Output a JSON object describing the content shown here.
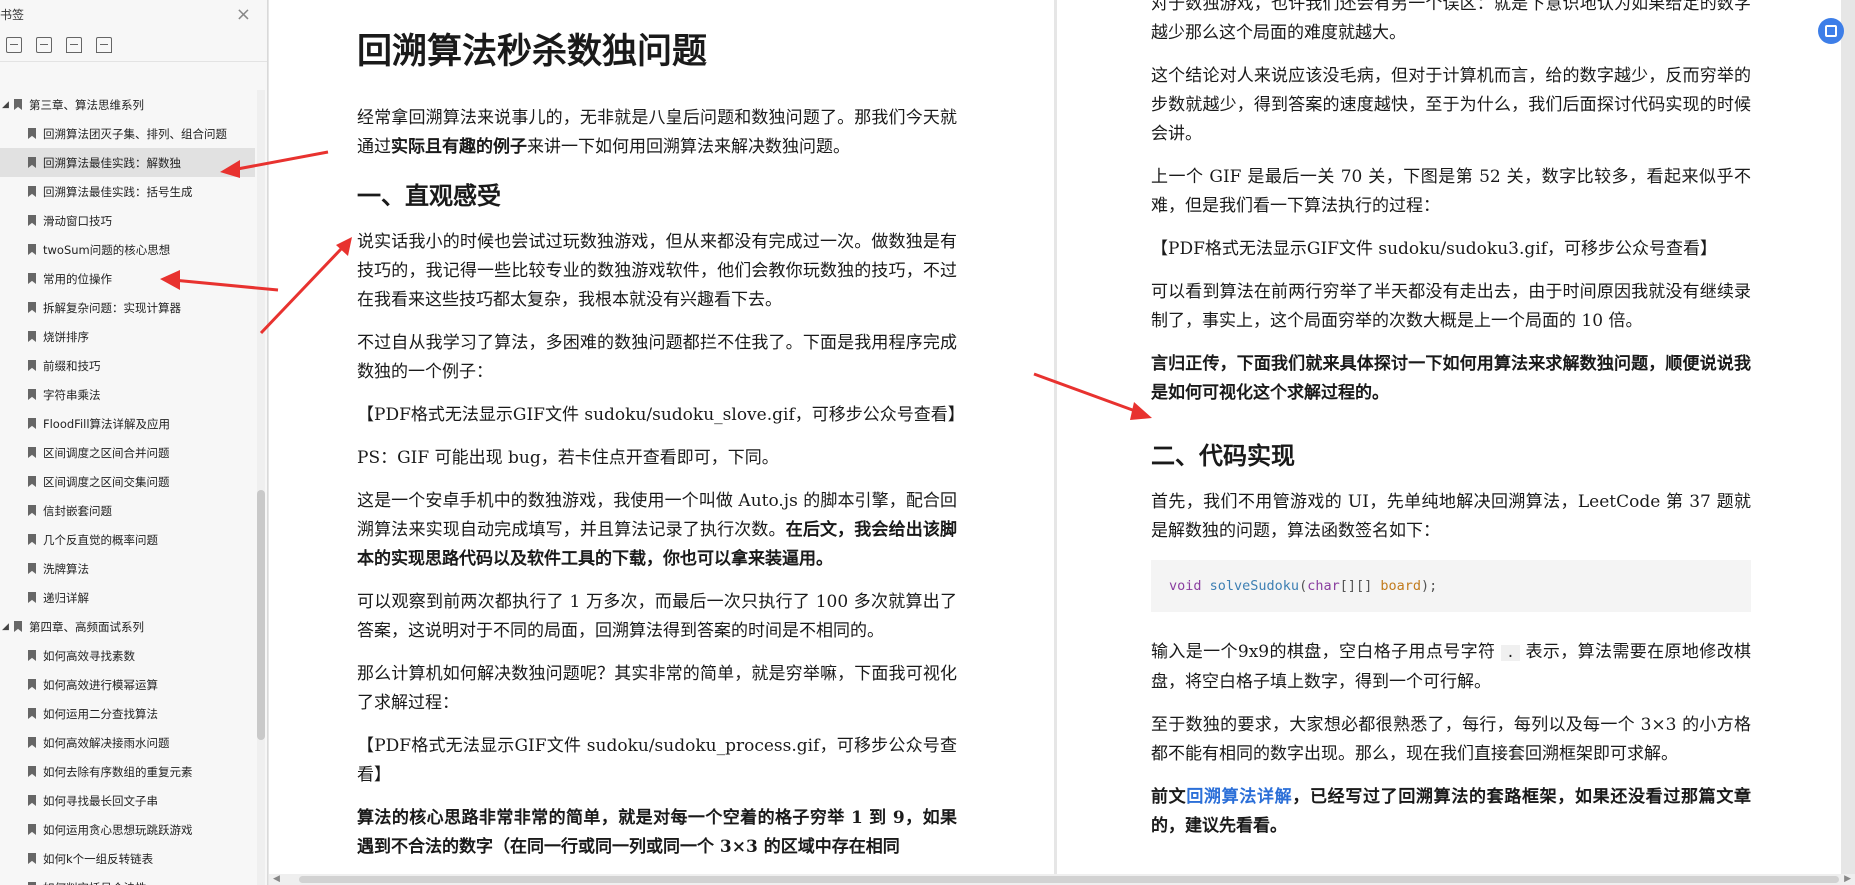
{
  "sidebar": {
    "title": "书签",
    "chapters": [
      {
        "label": "第三章、算法思维系列",
        "items": [
          "回溯算法团灭子集、排列、组合问题",
          "回溯算法最佳实践：解数独",
          "回溯算法最佳实践：括号生成",
          "滑动窗口技巧",
          "twoSum问题的核心思想",
          "常用的位操作",
          "拆解复杂问题：实现计算器",
          "烧饼排序",
          "前缀和技巧",
          "字符串乘法",
          "FloodFill算法详解及应用",
          "区间调度之区间合并问题",
          "区间调度之区间交集问题",
          "信封嵌套问题",
          "几个反直觉的概率问题",
          "洗牌算法",
          "递归详解"
        ]
      },
      {
        "label": "第四章、高频面试系列",
        "items": [
          "如何高效寻找素数",
          "如何高效进行模幂运算",
          "如何运用二分查找算法",
          "如何高效解决接雨水问题",
          "如何去除有序数组的重复元素",
          "如何寻找最长回文子串",
          "如何运用贪心思想玩跳跃游戏",
          "如何k个一组反转链表",
          "如何判定括号合法性"
        ]
      }
    ],
    "selected": "回溯算法最佳实践：解数独"
  },
  "left_page": {
    "title": "回溯算法秒杀数独问题",
    "p1_a": "经常拿回溯算法来说事儿的，无非就是八皇后问题和数独问题了。那我们今天就通过",
    "p1_b": "实际且有趣的例子",
    "p1_c": "来讲一下如何用回溯算法来解决数独问题。",
    "h1": "一、直观感受",
    "p2": "说实话我小的时候也尝试过玩数独游戏，但从来都没有完成过一次。做数独是有技巧的，我记得一些比较专业的数独游戏软件，他们会教你玩数独的技巧，不过在我看来这些技巧都太复杂，我根本就没有兴趣看下去。",
    "p3": "不过自从我学习了算法，多困难的数独问题都拦不住我了。下面是我用程序完成数独的一个例子：",
    "p4": "【PDF格式无法显示GIF文件 sudoku/sudoku_slove.gif，可移步公众号查看】",
    "p5": "PS：GIF 可能出现 bug，若卡住点开查看即可，下同。",
    "p6_a": "这是一个安卓手机中的数独游戏，我使用一个叫做 Auto.js 的脚本引擎，配合回溯算法来实现自动完成填写，并且算法记录了执行次数。",
    "p6_b": "在后文，我会给出该脚本的实现思路代码以及软件工具的下载，你也可以拿来装逼用。",
    "p7": "可以观察到前两次都执行了 1 万多次，而最后一次只执行了 100 多次就算出了答案，这说明对于不同的局面，回溯算法得到答案的时间是不相同的。",
    "p8": "那么计算机如何解决数独问题呢？其实非常的简单，就是穷举嘛，下面我可视化了求解过程：",
    "p9": "【PDF格式无法显示GIF文件 sudoku/sudoku_process.gif，可移步公众号查看】",
    "p10": "算法的核心思路非常非常的简单，就是对每一个空着的格子穷举 1 到 9，如果遇到不合法的数字（在同一行或同一列或同一个 3×3 的区域中存在相同"
  },
  "right_page": {
    "p0": "对于数独游戏，也许我们还会有另一个误区：就是下意识地认为如果给定的数字越少那么这个局面的难度就越大。",
    "p1": "这个结论对人来说应该没毛病，但对于计算机而言，给的数字越少，反而穷举的步数就越少，得到答案的速度越快，至于为什么，我们后面探讨代码实现的时候会讲。",
    "p2": "上一个 GIF 是最后一关 70 关，下图是第 52 关，数字比较多，看起来似乎不难，但是我们看一下算法执行的过程：",
    "p3": "【PDF格式无法显示GIF文件 sudoku/sudoku3.gif，可移步公众号查看】",
    "p4": "可以看到算法在前两行穷举了半天都没有走出去，由于时间原因我就没有继续录制了，事实上，这个局面穷举的次数大概是上一个局面的 10 倍。",
    "p5": "言归正传，下面我们就来具体探讨一下如何用算法来求解数独问题，顺便说说我是如何可视化这个求解过程的。",
    "h2": "二、代码实现",
    "p6": "首先，我们不用管游戏的 UI，先单纯地解决回溯算法，LeetCode 第 37 题就是解数独的问题，算法函数签名如下：",
    "code": {
      "kw": "void",
      "fn": "solveSudoku",
      "ty": "char",
      "brackets": "[][]",
      "arg": "board",
      "end": ");"
    },
    "p7_a": "输入是一个9x9的棋盘，空白格子用点号字符",
    "p7_code": ".",
    "p7_b": "表示，算法需要在原地修改棋盘，将空白格子填上数字，得到一个可行解。",
    "p8": "至于数独的要求，大家想必都很熟悉了，每行，每列以及每一个 3×3 的小方格都不能有相同的数字出现。那么，现在我们直接套回溯框架即可求解。",
    "p9_a": "前文",
    "p9_link": "回溯算法详解",
    "p9_b": "，已经写过了回溯算法的套路框架，如果还没看过那篇文章的，建议先看看。"
  },
  "colors": {
    "arrow": "#e8322f",
    "link": "#2b6fd8",
    "float_button": "#3d7ee8"
  }
}
